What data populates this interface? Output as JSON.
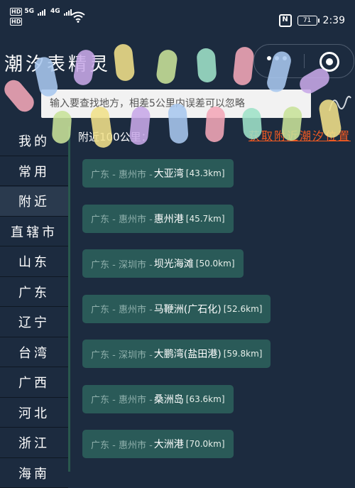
{
  "status_bar": {
    "hd1": "HD",
    "net1": "5G",
    "hd2": "HD",
    "net2": "4G",
    "battery": "71",
    "time": "2:39"
  },
  "app": {
    "title": "潮汐表精灵"
  },
  "search": {
    "placeholder": "输入要查找地方，相差5公里内误差可以忽略"
  },
  "content": {
    "nearby_label": "附近100公里：",
    "locate_link": "获取附近潮汐位置"
  },
  "sidebar": {
    "items": [
      {
        "label": "我的"
      },
      {
        "label": "常用"
      },
      {
        "label": "附近"
      },
      {
        "label": "直辖市"
      },
      {
        "label": "山东"
      },
      {
        "label": "广东"
      },
      {
        "label": "辽宁"
      },
      {
        "label": "台湾"
      },
      {
        "label": "广西"
      },
      {
        "label": "河北"
      },
      {
        "label": "浙江"
      },
      {
        "label": "海南"
      }
    ]
  },
  "places": [
    {
      "region": "广东 - 惠州市 - ",
      "name": "大亚湾",
      "distance": "[43.3km]"
    },
    {
      "region": "广东 - 惠州市 - ",
      "name": "惠州港",
      "distance": "[45.7km]"
    },
    {
      "region": "广东 - 深圳市 - ",
      "name": "坝光海滩",
      "distance": "[50.0km]"
    },
    {
      "region": "广东 - 惠州市 - ",
      "name": "马鞭洲(广石化)",
      "distance": "[52.6km]"
    },
    {
      "region": "广东 - 深圳市 - ",
      "name": "大鹏湾(盐田港)",
      "distance": "[59.8km]"
    },
    {
      "region": "广东 - 惠州市 - ",
      "name": "桑洲岛",
      "distance": "[63.6km]"
    },
    {
      "region": "广东 - 惠州市 - ",
      "name": "大洲港",
      "distance": "[70.0km]"
    }
  ],
  "colors": {
    "background": "#1c2b3f",
    "card": "#2a5a58",
    "accent_link": "#f15a22"
  }
}
